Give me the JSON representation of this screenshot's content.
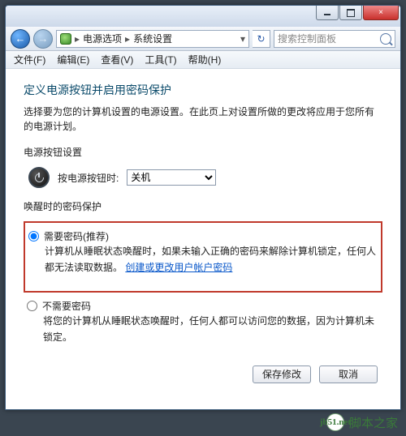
{
  "title_buttons": {
    "min": "–",
    "max": "□",
    "close": "×"
  },
  "nav": {
    "back": "←",
    "forward": "→",
    "refresh": "↻"
  },
  "breadcrumb": {
    "item1": "电源选项",
    "item2": "系统设置",
    "sep": "▸",
    "drop": "▾"
  },
  "search": {
    "placeholder": "搜索控制面板"
  },
  "menu": {
    "file": "文件(F)",
    "edit": "编辑(E)",
    "view": "查看(V)",
    "tools": "工具(T)",
    "help": "帮助(H)"
  },
  "heading": "定义电源按钮并启用密码保护",
  "description": "选择要为您的计算机设置的电源设置。在此页上对设置所做的更改将应用于您所有的电源计划。",
  "power_button_section": "电源按钮设置",
  "power_button_label": "按电源按钮时:",
  "power_button_value": "关机",
  "wake_section": "唤醒时的密码保护",
  "opt1": {
    "label": "需要密码(推荐)",
    "desc_a": "计算机从睡眠状态唤醒时，如果未输入正确的密码来解除计算机锁定，任何人都无法读取数据。",
    "link": "创建或更改用户帐户密码"
  },
  "opt2": {
    "label": "不需要密码",
    "desc": "将您的计算机从睡眠状态唤醒时，任何人都可以访问您的数据，因为计算机未锁定。"
  },
  "buttons": {
    "save": "保存修改",
    "cancel": "取消"
  },
  "watermark": {
    "site": "jb51.net",
    "name": "脚本之家"
  }
}
